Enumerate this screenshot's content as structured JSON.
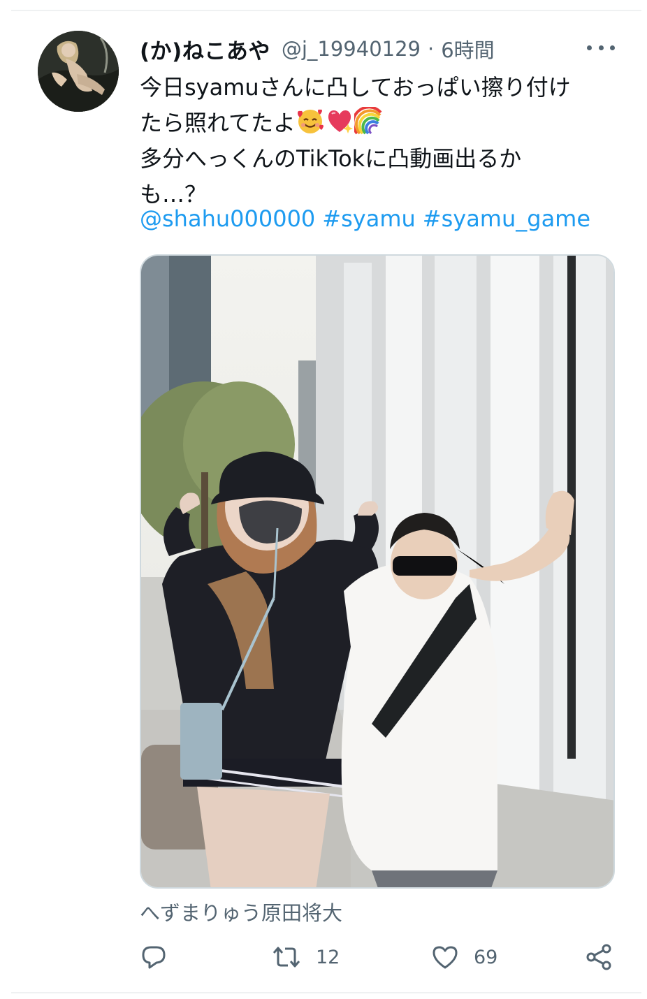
{
  "tweet": {
    "display_name": "(か)ねこあや",
    "handle": "@j_19940129",
    "separator": "·",
    "time": "6時間",
    "text_lines": [
      "今日syamuさんに凸しておっぱい擦り付け",
      "たら照れてたよ",
      "多分へっくんのTikTokに凸動画出るか",
      "も…？"
    ],
    "emojis": [
      "smiling-face-with-hearts-emoji",
      "heart-with-sparkles-emoji",
      "rainbow-emoji"
    ],
    "links": [
      "@shahu000000",
      "#syamu",
      "#syamu_game"
    ],
    "media_caption": "へずまりゅう原田将大"
  },
  "actions": {
    "reply_count": "",
    "retweet_count": "12",
    "like_count": "69",
    "share_count": ""
  },
  "colors": {
    "text": "#0f1419",
    "secondary": "#536471",
    "link": "#1d9bf0",
    "divider": "#eff1f2"
  }
}
